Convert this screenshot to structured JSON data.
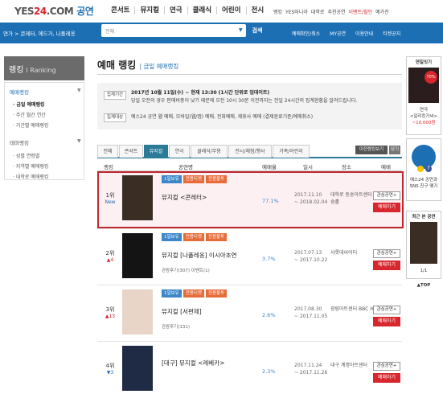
{
  "header": {
    "logo_yes": "YES",
    "logo_24": "24",
    "logo_com": ".COM",
    "logo_section": "공연",
    "nav": [
      "콘서트",
      "뮤지컬",
      "연극",
      "클래식",
      "어린이",
      "전시"
    ],
    "util": [
      "랭킹",
      "YES마니아",
      "대학로",
      "추천공연",
      "이벤트/할인",
      "예가진"
    ]
  },
  "bluebar": {
    "breadcrumb": "연가 > 콘레터, 에드가, 나폴레옹",
    "search_placeholder": "전체",
    "search_button": "검색",
    "links": [
      "예매확인/취소",
      "MY공연",
      "이용안내",
      "티켓공지"
    ]
  },
  "sidebar": {
    "title": "랭킹",
    "title_en": "I Ranking",
    "sections": [
      {
        "head": "예매랭킹",
        "items": [
          "· 금일 예매랭킹",
          "· 주간  월간  연간",
          "· 기간별 예매랭킹"
        ]
      },
      {
        "head": "테마랭킹",
        "items": [
          "· 성별  연령별",
          "· 지역별 예매랭킹",
          "· 대학로 예매랭킹"
        ]
      }
    ]
  },
  "main": {
    "title": "예매 랭킹",
    "subtitle": "| 금일 예매랭킹",
    "info": {
      "period_label": "집계기간",
      "period_line1": "2017년 10월 11일(수) ~ 현재 13:30 (1시간 단위로 업데이트)",
      "period_line2": "당일 오전의 경우 판매비중이 낮기 때문에 오전 10시 30분 이전까지는 전일 24시간의 집계현황을 알려드립니다.",
      "target_label": "집계대상",
      "target_text": "예스24 공연 웹 예매, 모바일(웹/앱) 예매, 전화예매, 제휴사 예매 (결제완료기준/예매취소)"
    },
    "tabs": [
      "전체",
      "콘서트",
      "뮤지컬",
      "연극",
      "클래식/무용",
      "전시/체험/행사",
      "가족/어린이"
    ],
    "active_tab": 2,
    "ticket_btn": "이전랭킹보기",
    "more_btn": "닫기",
    "columns": [
      "랭킹",
      "공연명",
      "예매율",
      "일시",
      "장소",
      "예매"
    ],
    "rows": [
      {
        "rank": "1위",
        "change": "New",
        "change_type": "new",
        "badges": [
          {
            "t": "1일보유",
            "c": "blue"
          },
          {
            "t": "전용티켓",
            "c": "orange"
          },
          {
            "t": "전용불투",
            "c": "orange"
          }
        ],
        "name": "뮤지컬 <콘레터>",
        "note": "",
        "rate": "77.1%",
        "date1": "2017.11.10",
        "date2": "~ 2018.02.04",
        "venue": "대학로 동숭아트센터 동숭홀",
        "interest": "관심공연+",
        "book": "예매하기",
        "poster": "#3a2e24"
      },
      {
        "rank": "2위",
        "change": "▲4",
        "change_type": "up",
        "badges": [
          {
            "t": "1일보유",
            "c": "blue"
          },
          {
            "t": "전용티켓",
            "c": "orange"
          },
          {
            "t": "전용불투",
            "c": "orange"
          }
        ],
        "name": "뮤지컬 [나폴레옹] 이시아초연",
        "note": "관람후기(307)  이벤트(1)",
        "rate": "3.7%",
        "date1": "2017.07.13",
        "date2": "~ 2017.10.22",
        "venue": "샤롯데씨어터",
        "interest": "관심공연+",
        "book": "예매하기",
        "poster": "#141414"
      },
      {
        "rank": "3위",
        "change": "▲13",
        "change_type": "up",
        "badges": [
          {
            "t": "1일보유",
            "c": "blue"
          },
          {
            "t": "전용티켓",
            "c": "orange"
          },
          {
            "t": "전용불투",
            "c": "orange"
          }
        ],
        "name": "뮤지컬 [서편제]",
        "note": "관람후기(131)",
        "rate": "2.6%",
        "date1": "2017.08.30",
        "date2": "~ 2017.11.05",
        "venue": "광림아트센터 BBC H홀",
        "interest": "관심공연+",
        "book": "예매하기",
        "poster": "#e9d5c8"
      },
      {
        "rank": "4위",
        "change": "▼3",
        "change_type": "down",
        "badges": [],
        "name": "[대구] 뮤지컬 <레베카>",
        "note": "",
        "rate": "2.3%",
        "date1": "2017.11.24",
        "date2": "~ 2017.11.26",
        "venue": "대구 계명아트센터",
        "interest": "관심공연+",
        "book": "예매하기",
        "poster": "#1f2a44"
      }
    ]
  },
  "rightbar": {
    "box1_title": "연일잇기",
    "box1_badge": "70%",
    "box1_text": "연극",
    "box1_text2": "<일리킹가씨>",
    "box1_price": "~10,000원",
    "box2_text": "예스24 공연과 SNS 친구 맺기",
    "box3_title": "최근 본 공연",
    "pager": "1/1",
    "top": "▲TOP"
  }
}
